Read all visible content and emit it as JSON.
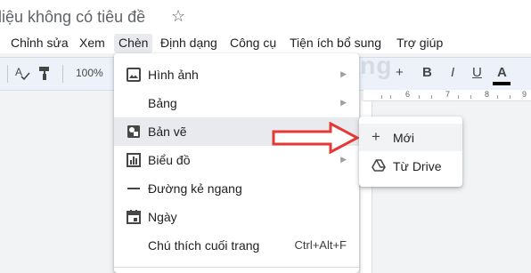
{
  "document": {
    "title": "liệu không có tiêu đề"
  },
  "menubar": {
    "items": [
      "Chỉnh sửa",
      "Xem",
      "Chèn",
      "Định dạng",
      "Công cụ",
      "Tiện ích bổ sung",
      "Trợ giúp"
    ],
    "active": "Chèn"
  },
  "toolbar": {
    "zoom": "100%",
    "icons": [
      "spellcheck-icon",
      "paint-format-icon",
      "bold-icon",
      "italic-icon",
      "underline-icon",
      "text-color-icon",
      "increase-font-icon"
    ],
    "bold": "B",
    "italic": "I",
    "underline": "U",
    "text_color": "A",
    "plus": "+"
  },
  "ruler": {
    "labels": [
      "6",
      "7",
      "8",
      "9"
    ]
  },
  "watermark": {
    "text": "uantrimang"
  },
  "insert_menu": {
    "items": [
      {
        "label": "Hình ảnh",
        "icon": "image-icon",
        "submenu": true
      },
      {
        "label": "Bảng",
        "icon": "",
        "submenu": true
      },
      {
        "label": "Bản vẽ",
        "icon": "drawing-icon",
        "submenu": true
      },
      {
        "label": "Biểu đồ",
        "icon": "chart-icon",
        "submenu": true
      },
      {
        "label": "Đường kẻ ngang",
        "icon": "horizontal-line-icon",
        "submenu": false
      },
      {
        "label": "Ngày",
        "icon": "calendar-icon",
        "submenu": false
      },
      {
        "label": "Chú thích cuối trang",
        "icon": "",
        "shortcut": "Ctrl+Alt+F"
      }
    ]
  },
  "drawing_submenu": {
    "items": [
      {
        "label": "Mới",
        "icon": "plus-icon"
      },
      {
        "label": "Từ Drive",
        "icon": "google-drive-icon"
      }
    ]
  },
  "colors": {
    "annotation": "#e53935",
    "hover": "#e8eaed",
    "text_color_bar": "#000000"
  }
}
